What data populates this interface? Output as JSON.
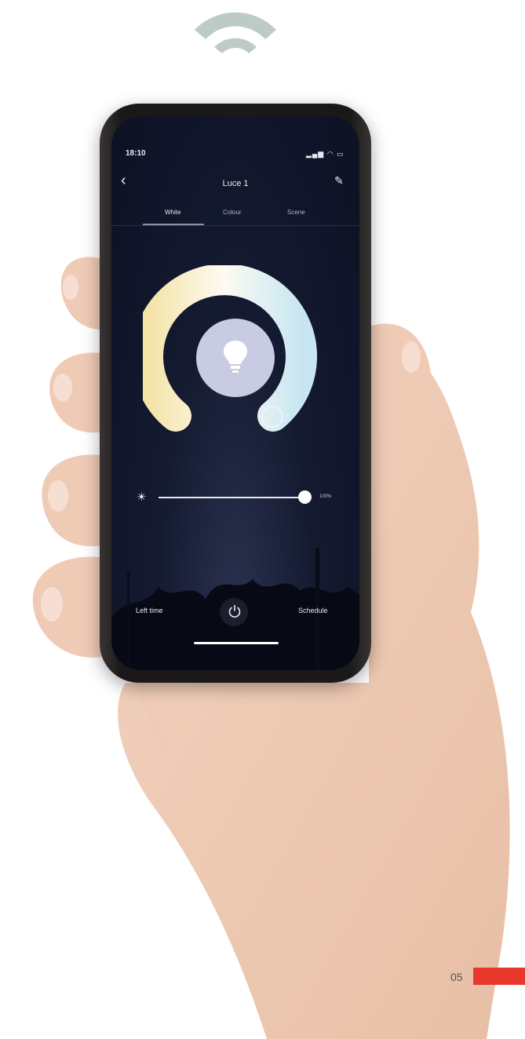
{
  "colors": {
    "accent_red": "#e8372b",
    "wifi": "#bccbc8",
    "screen_bg": "#141a30",
    "ring_warm": "#f4e3a6",
    "ring_cool": "#c7e6f2"
  },
  "decor": {
    "wifi_icon": "wifi-icon"
  },
  "phone": {
    "status": {
      "time": "18:10",
      "icons": "signal wifi battery"
    },
    "header": {
      "title": "Luce 1",
      "back_icon": "chevron-left-icon",
      "edit_icon": "pencil-icon"
    },
    "tabs": [
      {
        "label": "White",
        "active": true
      },
      {
        "label": "Colour",
        "active": false
      },
      {
        "label": "Scene",
        "active": false
      }
    ],
    "bulb_icon": "lightbulb-icon",
    "brightness": {
      "icon": "sun-icon",
      "value": "100%",
      "level": 1.0
    },
    "bottom": {
      "left_label": "Left time",
      "power_icon": "power-icon",
      "right_label": "Schedule"
    }
  },
  "footer": {
    "page_number": "05"
  }
}
